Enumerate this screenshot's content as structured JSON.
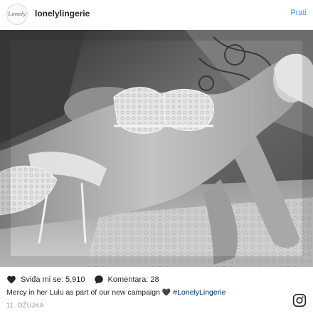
{
  "post": {
    "avatar_text": "Lonely",
    "username": "lonelylingerie",
    "follow_label": "Prati",
    "likes_label": "Sviđa mi se: 5,910",
    "comments_label": "Komentara: 28",
    "caption_text": "Mercy in her Lulu as part of our new campaign",
    "caption_heart": "🖤",
    "caption_hashtag": "#LonelyLingerie",
    "date": "11. OŽUJKA"
  },
  "icons": {
    "like": "heart-icon",
    "comment": "comment-bubble-icon",
    "brand": "instagram-icon"
  },
  "colors": {
    "follow_link": "#3897f0",
    "hashtag": "#003569",
    "date_text": "#999999",
    "text": "#262626"
  }
}
